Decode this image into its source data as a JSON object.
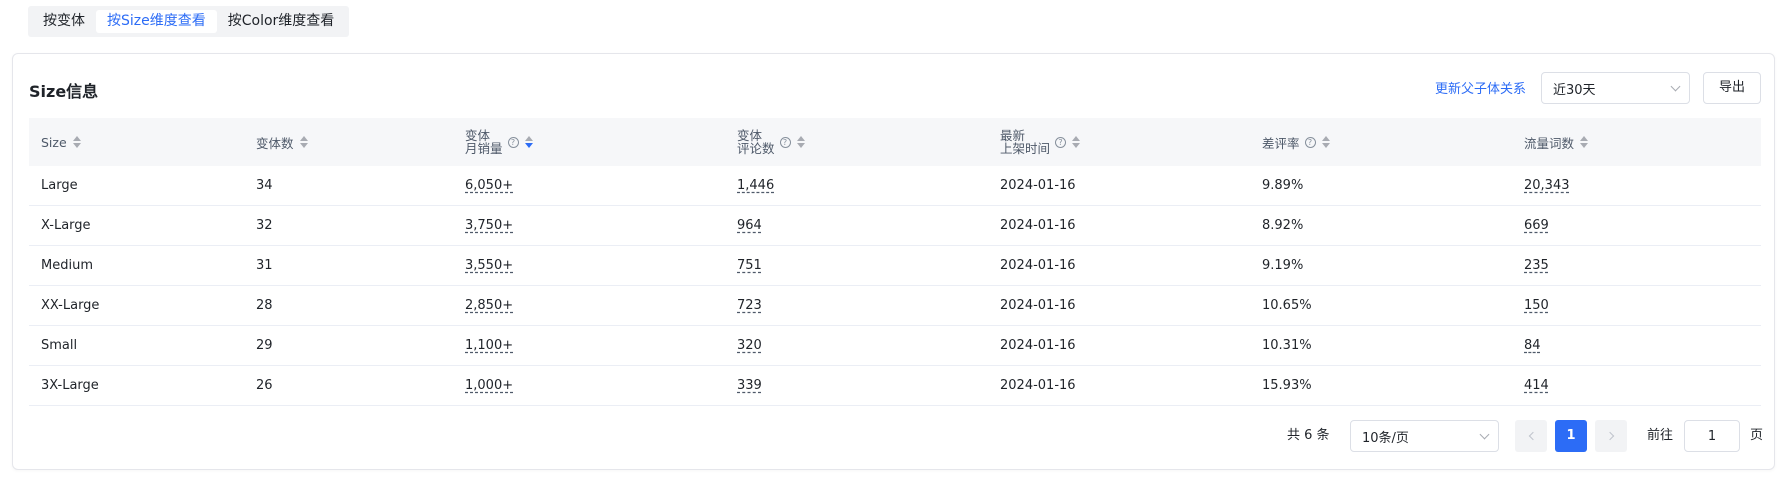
{
  "tabs": [
    {
      "label": "按变体",
      "active": false
    },
    {
      "label": "按Size维度查看",
      "active": true
    },
    {
      "label": "按Color维度查看",
      "active": false
    }
  ],
  "card": {
    "title": "Size信息",
    "update_link": "更新父子体关系",
    "date_range": "近30天",
    "export_label": "导出"
  },
  "table": {
    "headers": {
      "size": "Size",
      "variants": "变体数",
      "monthly_sales_1": "变体",
      "monthly_sales_2": "月销量",
      "reviews_1": "变体",
      "reviews_2": "评论数",
      "listed_1": "最新",
      "listed_2": "上架时间",
      "bad_rate": "差评率",
      "traffic": "流量词数"
    },
    "rows": [
      {
        "size": "Large",
        "variants": "34",
        "sales": "6,050+",
        "reviews": "1,446",
        "listed": "2024-01-16",
        "bad_rate": "9.89%",
        "traffic": "20,343"
      },
      {
        "size": "X-Large",
        "variants": "32",
        "sales": "3,750+",
        "reviews": "964",
        "listed": "2024-01-16",
        "bad_rate": "8.92%",
        "traffic": "669"
      },
      {
        "size": "Medium",
        "variants": "31",
        "sales": "3,550+",
        "reviews": "751",
        "listed": "2024-01-16",
        "bad_rate": "9.19%",
        "traffic": "235"
      },
      {
        "size": "XX-Large",
        "variants": "28",
        "sales": "2,850+",
        "reviews": "723",
        "listed": "2024-01-16",
        "bad_rate": "10.65%",
        "traffic": "150"
      },
      {
        "size": "Small",
        "variants": "29",
        "sales": "1,100+",
        "reviews": "320",
        "listed": "2024-01-16",
        "bad_rate": "10.31%",
        "traffic": "84"
      },
      {
        "size": "3X-Large",
        "variants": "26",
        "sales": "1,000+",
        "reviews": "339",
        "listed": "2024-01-16",
        "bad_rate": "15.93%",
        "traffic": "414"
      }
    ]
  },
  "pagination": {
    "total": "共 6 条",
    "page_size": "10条/页",
    "current_page": "1",
    "goto_label": "前往",
    "goto_value": "1",
    "page_unit": "页"
  },
  "colors": {
    "accent": "#2c6cf6",
    "header_bg": "#f6f7f9",
    "tab_bg": "#f2f3f5"
  }
}
